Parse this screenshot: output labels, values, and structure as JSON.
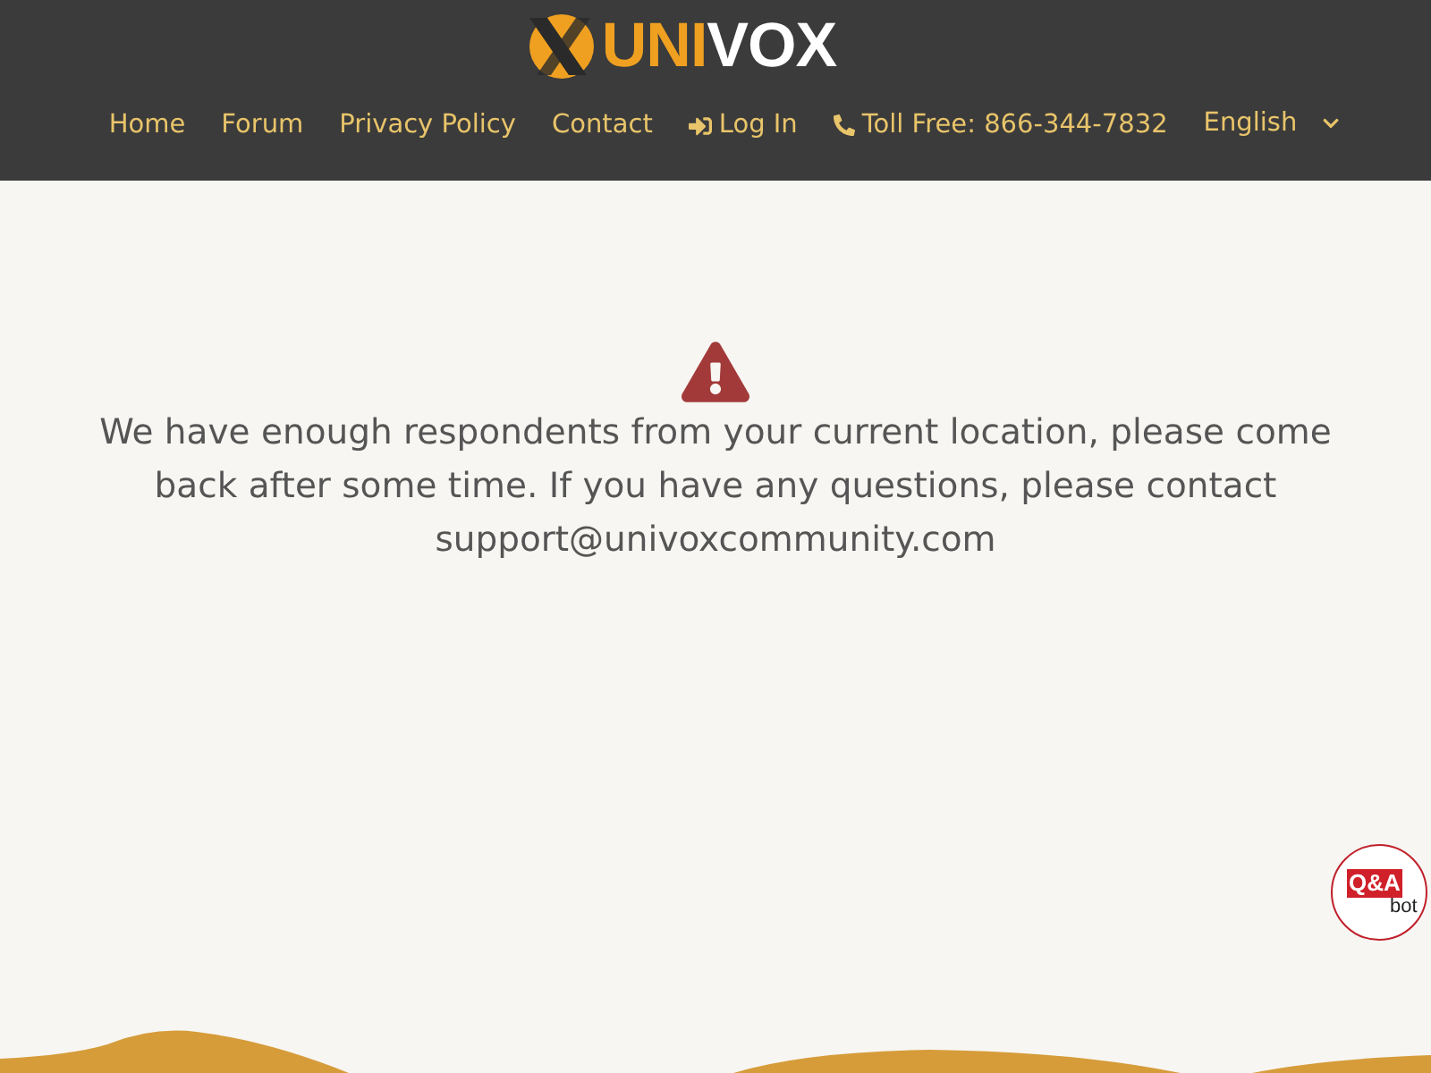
{
  "logo": {
    "accent": "UNI",
    "rest": "VOX"
  },
  "nav": [
    {
      "label": "Home",
      "kind": "link"
    },
    {
      "label": "Forum",
      "kind": "link"
    },
    {
      "label": "Privacy Policy",
      "kind": "link"
    },
    {
      "label": "Contact",
      "kind": "link"
    },
    {
      "label": "Log In",
      "kind": "login"
    },
    {
      "label": "Toll Free: 866-344-7832",
      "kind": "phone"
    }
  ],
  "language": {
    "value": "English"
  },
  "message": "We have enough respondents from your current location, please come back after some time. If you have any questions, please contact support@univoxcommunity.com",
  "chat_badge": {
    "title": "Q&A",
    "subtitle": "bot"
  }
}
